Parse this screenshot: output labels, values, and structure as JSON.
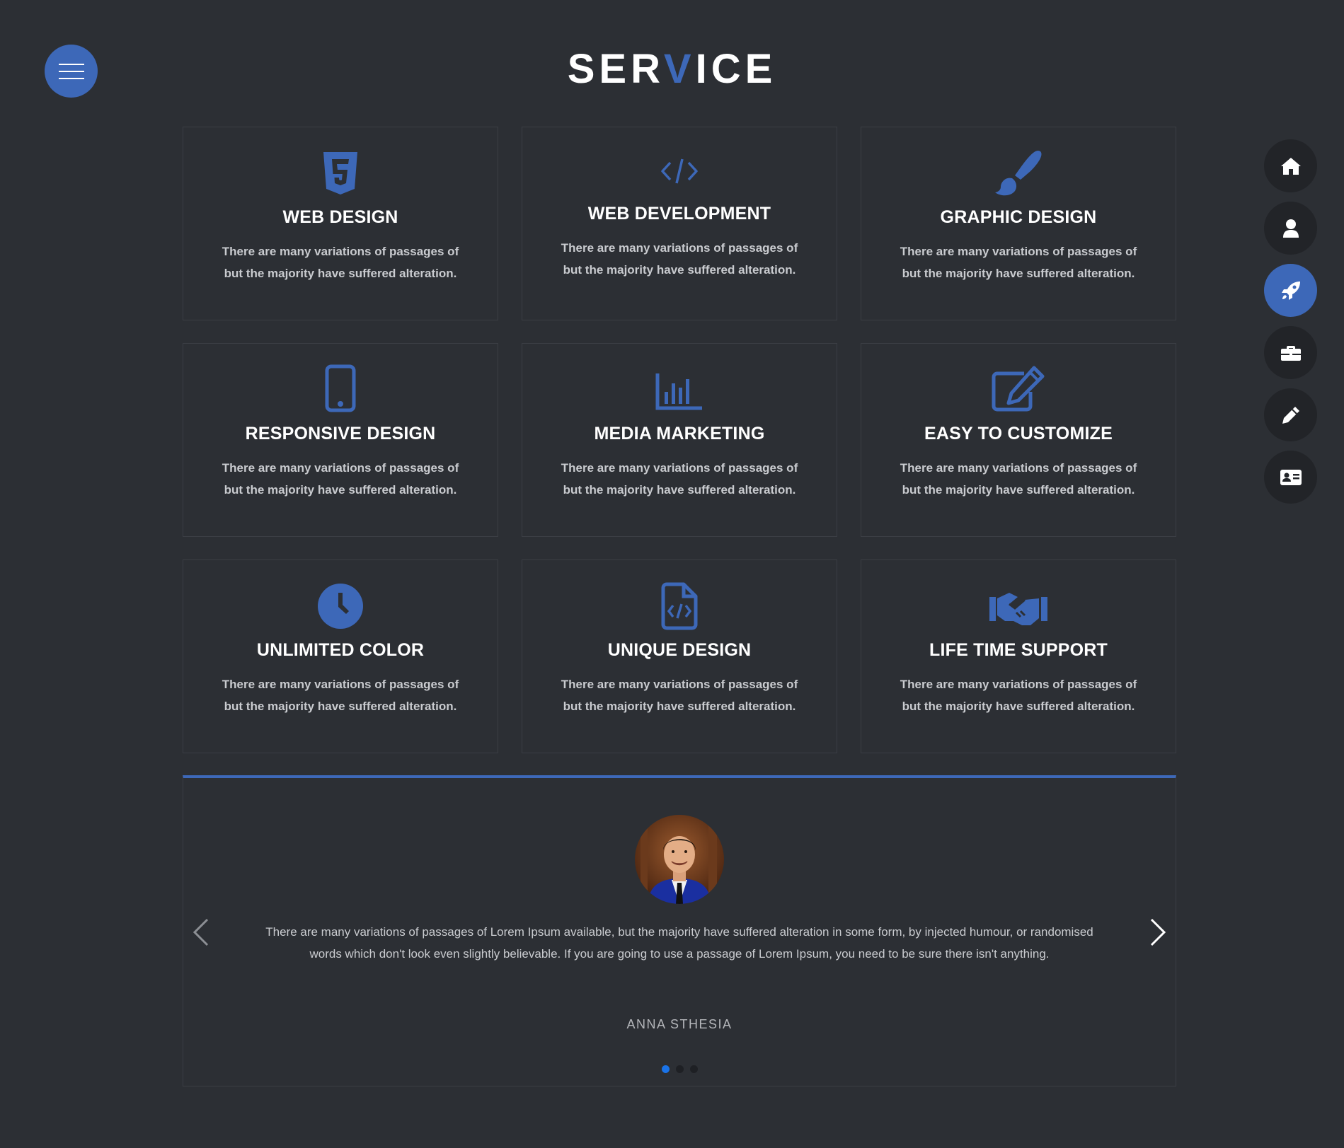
{
  "colors": {
    "accent": "#3d68b8",
    "background": "#2c2f34",
    "active_dot": "#1a73e8"
  },
  "menu": {
    "icon": "hamburger-icon"
  },
  "header": {
    "title_part1": "SER",
    "title_accent": "V",
    "title_part2": "ICE"
  },
  "services": [
    {
      "icon": "html5-icon",
      "title": "WEB DESIGN",
      "desc_line1": "There are many variations of passages of",
      "desc_line2": "but the majority have suffered alteration."
    },
    {
      "icon": "code-icon",
      "title": "WEB DEVELOPMENT",
      "desc_line1": "There are many variations of passages of",
      "desc_line2": "but the majority have suffered alteration."
    },
    {
      "icon": "paint-brush-icon",
      "title": "GRAPHIC DESIGN",
      "desc_line1": "There are many variations of passages of",
      "desc_line2": "but the majority have suffered alteration."
    },
    {
      "icon": "mobile-icon",
      "title": "RESPONSIVE DESIGN",
      "desc_line1": "There are many variations of passages of",
      "desc_line2": "but the majority have suffered alteration."
    },
    {
      "icon": "bar-chart-icon",
      "title": "MEDIA MARKETING",
      "desc_line1": "There are many variations of passages of",
      "desc_line2": "but the majority have suffered alteration."
    },
    {
      "icon": "edit-icon",
      "title": "EASY TO CUSTOMIZE",
      "desc_line1": "There are many variations of passages of",
      "desc_line2": "but the majority have suffered alteration."
    },
    {
      "icon": "clock-icon",
      "title": "UNLIMITED COLOR",
      "desc_line1": "There are many variations of passages of",
      "desc_line2": "but the majority have suffered alteration."
    },
    {
      "icon": "file-code-icon",
      "title": "UNIQUE DESIGN",
      "desc_line1": "There are many variations of passages of",
      "desc_line2": "but the majority have suffered alteration."
    },
    {
      "icon": "handshake-icon",
      "title": "LIFE TIME SUPPORT",
      "desc_line1": "There are many variations of passages of",
      "desc_line2": "but the majority have suffered alteration."
    }
  ],
  "side_nav": [
    {
      "icon": "home-icon",
      "active": false
    },
    {
      "icon": "user-icon",
      "active": false
    },
    {
      "icon": "rocket-icon",
      "active": true
    },
    {
      "icon": "briefcase-icon",
      "active": false
    },
    {
      "icon": "pencil-icon",
      "active": false
    },
    {
      "icon": "contact-card-icon",
      "active": false
    }
  ],
  "testimonial": {
    "quote": "There are many variations of passages of Lorem Ipsum available, but the majority have suffered alteration in some form, by injected humour, or randomised words which don't look even slightly believable. If you are going to use a passage of Lorem Ipsum, you need to be sure there isn't anything.",
    "author": "ANNA STHESIA",
    "slide_count": 3,
    "active_slide": 1
  }
}
